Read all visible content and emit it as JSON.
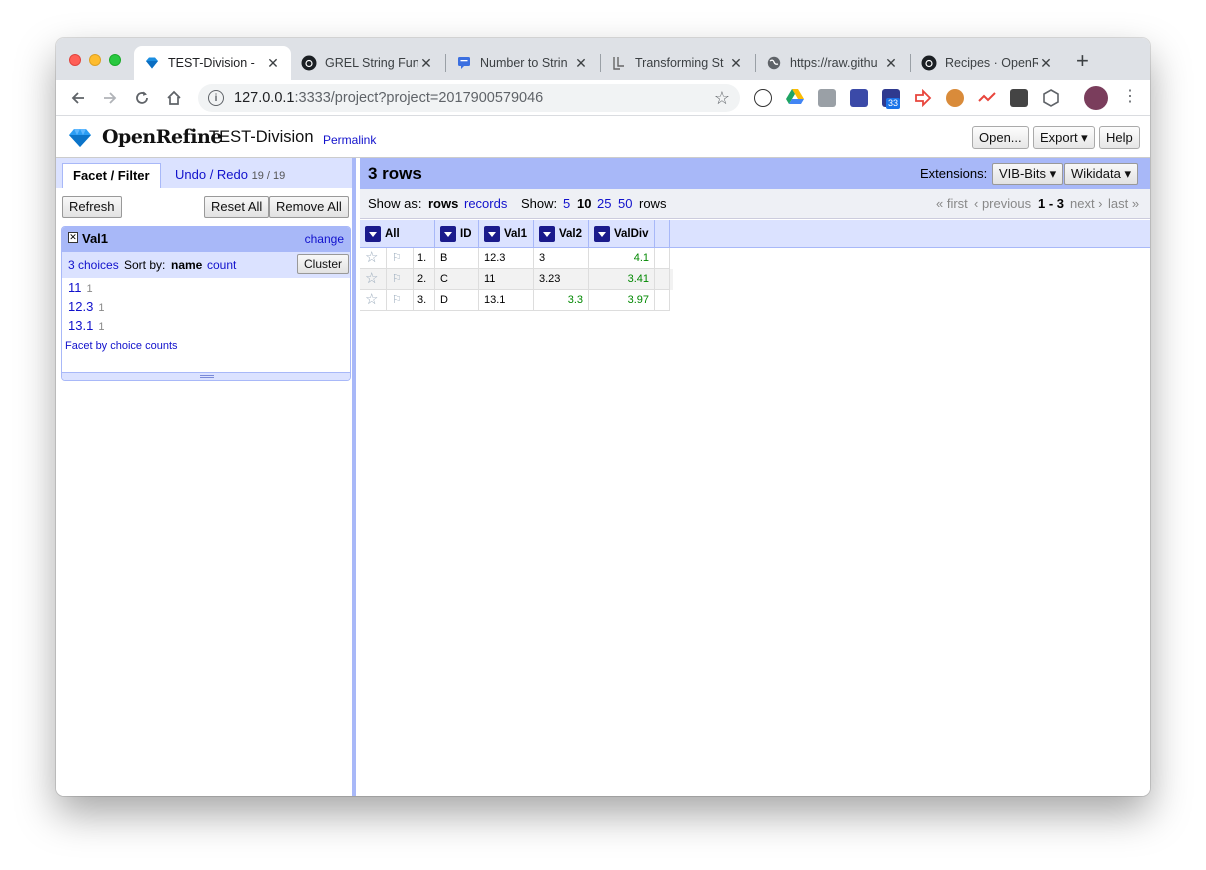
{
  "browser": {
    "tabs": [
      {
        "title": "TEST-Division -",
        "icon": "openrefine-diamond-icon"
      },
      {
        "title": "GREL String Fun",
        "icon": "github-icon"
      },
      {
        "title": "Number to Strin",
        "icon": "chat-icon"
      },
      {
        "title": "Transforming St",
        "icon": "bracket-icon"
      },
      {
        "title": "https://raw.githu",
        "icon": "globe-icon"
      },
      {
        "title": "Recipes · OpenR",
        "icon": "github-icon"
      }
    ],
    "url_host": "127.0.0.1",
    "url_path": ":3333/project?project=2017900579046",
    "ext_badge": "33"
  },
  "app": {
    "brand": "OpenRefine",
    "project_name": "TEST-Division",
    "permalink": "Permalink",
    "open_label": "Open...",
    "export_label": "Export ▾",
    "help_label": "Help"
  },
  "left": {
    "tab_facet": "Facet / Filter",
    "tab_undo": "Undo / Redo",
    "undo_count": "19 / 19",
    "refresh": "Refresh",
    "reset_all": "Reset All",
    "remove_all": "Remove All",
    "facet": {
      "title": "Val1",
      "change": "change",
      "choices_count": "3 choices",
      "sort_by": "Sort by:",
      "sort_name": "name",
      "sort_count": "count",
      "cluster": "Cluster",
      "choices": [
        {
          "value": "11",
          "count": "1"
        },
        {
          "value": "12.3",
          "count": "1"
        },
        {
          "value": "13.1",
          "count": "1"
        }
      ],
      "facet_by_counts": "Facet by choice counts"
    }
  },
  "right": {
    "rows_title": "3 rows",
    "extensions_label": "Extensions:",
    "ext_vib": "VIB-Bits ▾",
    "ext_wikidata": "Wikidata ▾",
    "show_as": "Show as:",
    "rows": "rows",
    "records": "records",
    "show": "Show:",
    "page_sizes": [
      "5",
      "10",
      "25",
      "50"
    ],
    "rows_suffix": "rows",
    "pager_first": "« first",
    "pager_prev": "‹ previous",
    "pager_range": "1 - 3",
    "pager_next": "next ›",
    "pager_last": "last »",
    "columns": [
      "All",
      "ID",
      "Val1",
      "Val2",
      "ValDiv"
    ],
    "data_rows": [
      {
        "index": "1.",
        "ID": "B",
        "Val1": "12.3",
        "Val2": "3",
        "ValDiv": "4.1"
      },
      {
        "index": "2.",
        "ID": "C",
        "Val1": "11",
        "Val2": "3.23",
        "ValDiv": "3.41"
      },
      {
        "index": "3.",
        "ID": "D",
        "Val1": "13.1",
        "Val2": "3.3",
        "ValDiv": "3.97"
      }
    ]
  }
}
